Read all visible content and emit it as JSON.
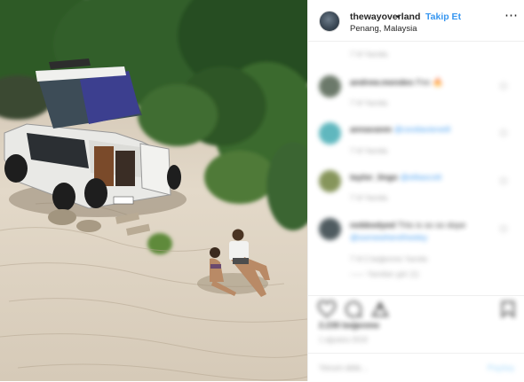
{
  "post": {
    "username": "thewayoverland",
    "separator": "•",
    "follow_label": "Takip Et",
    "location": "Penang, Malaysia",
    "more_icon": "more-horizontal-icon"
  },
  "comments": [
    {
      "username": "",
      "text": "",
      "meta": "7 hf   Yanıtla"
    },
    {
      "username": "andrew.mendes",
      "text": "Fire 🔥",
      "meta": "7 hf   Yanıtla"
    },
    {
      "username": "annavanm",
      "text": "@cestlavieneill",
      "meta": "7 hf   Yanıtla"
    },
    {
      "username": "taylor_lingo",
      "text": "@elliascott",
      "meta": "7 hf   Yanıtla"
    },
    {
      "username": "nobbodyed",
      "text": "This is so so dope",
      "mention": "@somewherefreeley",
      "meta": "7 hf   2 beğenme   Yanıtla",
      "replies": "—— Yanıtları gör (1)"
    }
  ],
  "footer": {
    "likes": "2.230 beğenme",
    "date": "1 ağustos 2019",
    "add_comment_placeholder": "Yorum ekle...",
    "share_label": "Paylaş"
  },
  "colors": {
    "accent": "#3897f0",
    "text": "#262626",
    "muted": "#999999",
    "divider": "#efefef"
  }
}
